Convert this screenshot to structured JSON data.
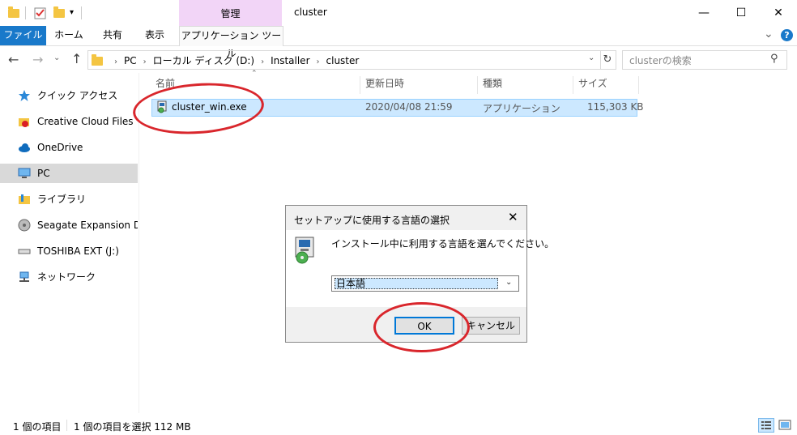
{
  "titlebar": {
    "manage_tab": "管理",
    "window_title": "cluster",
    "minimize": "—",
    "maximize": "☐",
    "close": "✕"
  },
  "ribbon": {
    "file": "ファイル",
    "home": "ホーム",
    "share": "共有",
    "view": "表示",
    "app_tools": "アプリケーション ツール",
    "collapse": "⌄",
    "help": "?"
  },
  "address": {
    "crumbs": [
      "PC",
      "ローカル ディスク (D:)",
      "Installer",
      "cluster"
    ],
    "search_placeholder": "clusterの検索"
  },
  "nav": {
    "items": [
      {
        "label": "クイック アクセス",
        "icon": "star-icon"
      },
      {
        "label": "Creative Cloud Files",
        "icon": "creative-cloud-folder-icon"
      },
      {
        "label": "OneDrive",
        "icon": "cloud-icon"
      },
      {
        "label": "PC",
        "icon": "monitor-icon"
      },
      {
        "label": "ライブラリ",
        "icon": "library-icon"
      },
      {
        "label": "Seagate Expansion Drive",
        "icon": "drive-icon"
      },
      {
        "label": "TOSHIBA EXT (J:)",
        "icon": "usb-drive-icon"
      },
      {
        "label": "ネットワーク",
        "icon": "network-icon"
      }
    ]
  },
  "list": {
    "columns": {
      "name": "名前",
      "modified": "更新日時",
      "type": "種類",
      "size": "サイズ"
    },
    "rows": [
      {
        "name": "cluster_win.exe",
        "modified": "2020/04/08 21:59",
        "type": "アプリケーション",
        "size": "115,303 KB"
      }
    ]
  },
  "dialog": {
    "title": "セットアップに使用する言語の選択",
    "message": "インストール中に利用する言語を選んでください。",
    "selected_language": "日本語",
    "ok": "OK",
    "cancel": "キャンセル"
  },
  "status": {
    "item_count": "1 個の項目",
    "selection": "1 個の項目を選択  112 MB"
  },
  "colors": {
    "file_tab": "#1979ca",
    "manage_tab": "#f2d5f7",
    "selection": "#cce8ff",
    "annotation_ring": "#d9262c"
  }
}
